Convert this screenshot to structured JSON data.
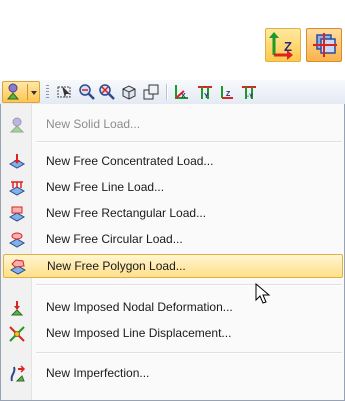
{
  "top_icons": [
    {
      "name": "z-axis-load-icon",
      "label": "Z"
    },
    {
      "name": "sectional-view-icon"
    }
  ],
  "toolbar": {
    "dropdown_icon": "new-load-icon",
    "buttons": [
      "select-icon",
      "zoom-window-icon",
      "zoom-all-icon",
      "cube-view-icon",
      "iso-view-icon",
      "x-axis-view-icon",
      "y-axis-view-icon",
      "z-axis-view-icon",
      "minus-y-axis-view-icon"
    ]
  },
  "menu": {
    "items": [
      {
        "label": "New Solid Load...",
        "icon": "solid-load-icon",
        "enabled": false
      },
      {
        "label": "New Free Concentrated Load...",
        "icon": "free-concentrated-load-icon",
        "enabled": true
      },
      {
        "label": "New Free Line Load...",
        "icon": "free-line-load-icon",
        "enabled": true
      },
      {
        "label": "New Free Rectangular Load...",
        "icon": "free-rectangular-load-icon",
        "enabled": true
      },
      {
        "label": "New Free Circular Load...",
        "icon": "free-circular-load-icon",
        "enabled": true
      },
      {
        "label": "New Free Polygon Load...",
        "icon": "free-polygon-load-icon",
        "enabled": true,
        "highlighted": true
      },
      {
        "label": "New Imposed Nodal Deformation...",
        "icon": "imposed-nodal-deformation-icon",
        "enabled": true
      },
      {
        "label": "New Imposed Line Displacement...",
        "icon": "imposed-line-displacement-icon",
        "enabled": true
      },
      {
        "label": "New Imperfection...",
        "icon": "imperfection-icon",
        "enabled": true
      }
    ]
  },
  "colors": {
    "highlight": "#ffe08a",
    "highlight_border": "#e0b040",
    "menu_bg": "#fafafa",
    "disabled_text": "#8d8d8d"
  }
}
